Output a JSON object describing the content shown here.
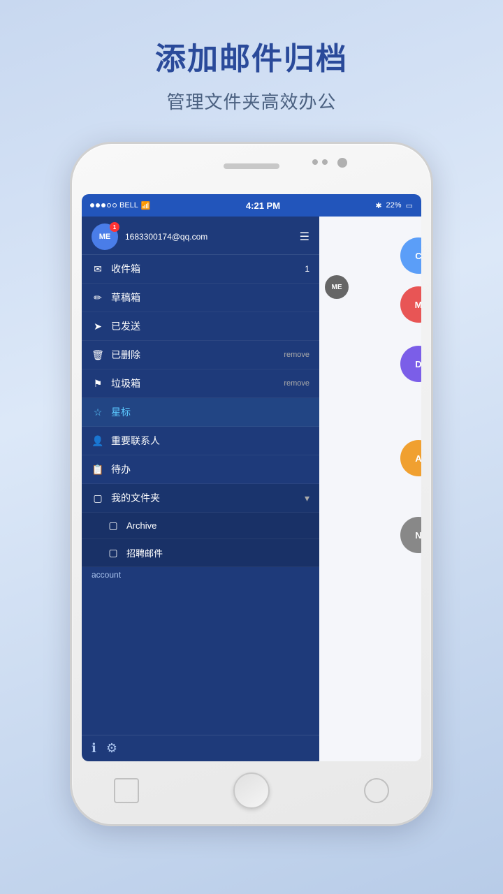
{
  "page": {
    "title": "添加邮件归档",
    "subtitle": "管理文件夹高效办公"
  },
  "status_bar": {
    "signal": "●●●○○",
    "carrier": "BELL",
    "wifi": "wifi",
    "time": "4:21 PM",
    "bluetooth": "B",
    "battery": "22%"
  },
  "account": {
    "email": "1683300174@qq.com",
    "avatar": "ME",
    "badge": "1"
  },
  "nav_items": [
    {
      "icon": "✉",
      "label": "收件箱",
      "badge": "1",
      "remove": ""
    },
    {
      "icon": "✎",
      "label": "草稿箱",
      "badge": "",
      "remove": ""
    },
    {
      "icon": "✈",
      "label": "已发送",
      "badge": "",
      "remove": ""
    },
    {
      "icon": "🗑",
      "label": "已删除",
      "badge": "",
      "remove": "remove"
    },
    {
      "icon": "⚑",
      "label": "垃圾箱",
      "badge": "",
      "remove": "remove"
    },
    {
      "icon": "☆",
      "label": "星标",
      "badge": "",
      "remove": "",
      "starred": true
    },
    {
      "icon": "👤",
      "label": "重要联系人",
      "badge": "",
      "remove": ""
    },
    {
      "icon": "📋",
      "label": "待办",
      "badge": "",
      "remove": ""
    }
  ],
  "folder_section": {
    "label": "我的文件夹",
    "icon": "▢",
    "arrow": "▾",
    "sub_folders": [
      {
        "label": "Archive"
      },
      {
        "label": "招聘邮件"
      }
    ]
  },
  "bottom": {
    "account_label": "account"
  },
  "right_circles": [
    {
      "label": "C",
      "color": "#5b9ef8"
    },
    {
      "label": "M",
      "color": "#e85555"
    },
    {
      "label": "D",
      "color": "#7b5ee8"
    },
    {
      "label": "A",
      "color": "#f0a030"
    },
    {
      "label": "N",
      "color": "#888"
    }
  ]
}
